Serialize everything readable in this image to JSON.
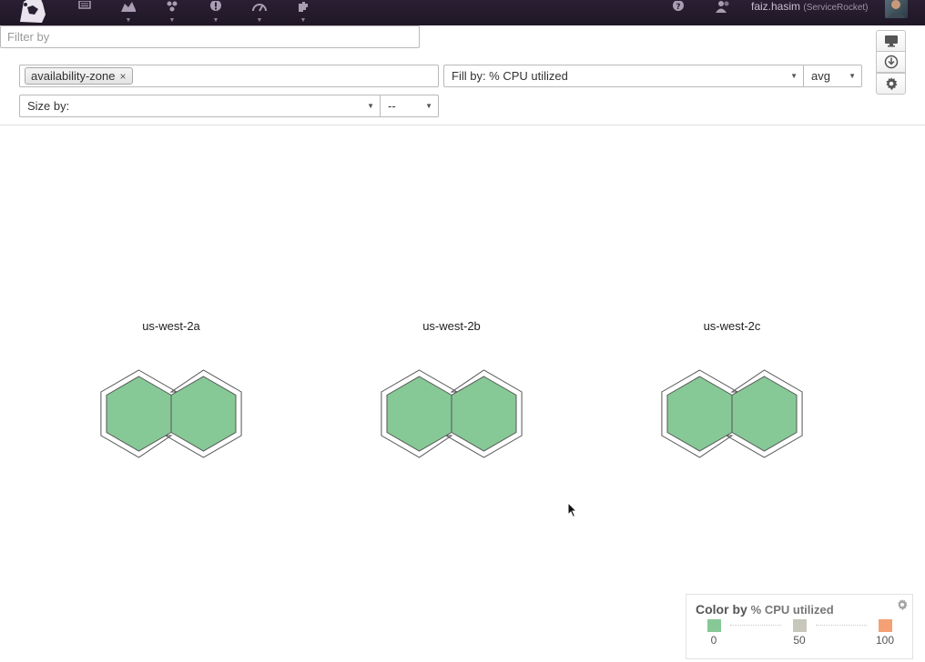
{
  "topbar": {
    "user_name": "faiz.hasim",
    "user_org": "(ServiceRocket)",
    "nav_icons": [
      "dashboard-icon",
      "graph-icon",
      "infrastructure-icon",
      "monitors-icon",
      "metrics-icon",
      "integrations-icon"
    ],
    "right_icons": [
      "help-icon",
      "team-icon"
    ]
  },
  "controls": {
    "filter_placeholder": "Filter by",
    "group_tag": "availability-zone",
    "group_tag_remove": "×",
    "fill_by": "Fill by: % CPU utilized",
    "fill_aggregation": "avg",
    "size_by": "Size by:",
    "size_aggregation": "--",
    "caret": "▼"
  },
  "zones": [
    {
      "name": "us-west-2a",
      "hosts": 2,
      "fill": "#86c997"
    },
    {
      "name": "us-west-2b",
      "hosts": 2,
      "fill": "#86c997"
    },
    {
      "name": "us-west-2c",
      "hosts": 2,
      "fill": "#86c997"
    }
  ],
  "legend": {
    "title": "Color by",
    "metric": "% CPU utilized",
    "stops": [
      {
        "label": "0",
        "color": "#86c997"
      },
      {
        "label": "50",
        "color": "#c7c7bc"
      },
      {
        "label": "100",
        "color": "#f5a074"
      }
    ]
  }
}
